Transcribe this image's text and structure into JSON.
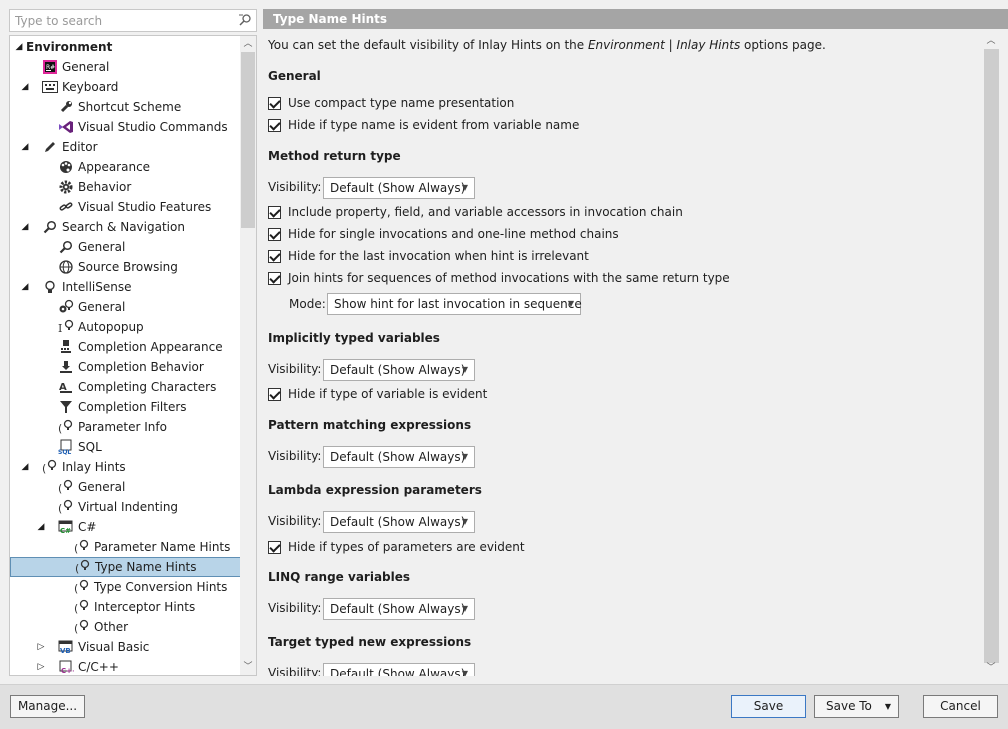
{
  "search": {
    "placeholder": "Type to search"
  },
  "tree": {
    "items": [
      {
        "label": "Environment",
        "bold": true,
        "expanded": true,
        "icon": "none"
      },
      {
        "label": "General",
        "icon": "resharper-icon"
      },
      {
        "label": "Keyboard",
        "expanded": true,
        "icon": "keyboard-icon"
      },
      {
        "label": "Shortcut Scheme",
        "icon": "wrench-icon"
      },
      {
        "label": "Visual Studio Commands",
        "icon": "visual-studio-icon"
      },
      {
        "label": "Editor",
        "expanded": true,
        "icon": "pencil-icon"
      },
      {
        "label": "Appearance",
        "icon": "palette-icon"
      },
      {
        "label": "Behavior",
        "icon": "gear-icon"
      },
      {
        "label": "Visual Studio Features",
        "icon": "link-icon"
      },
      {
        "label": "Search & Navigation",
        "expanded": true,
        "icon": "magnifier-icon"
      },
      {
        "label": "General",
        "icon": "magnifier-icon"
      },
      {
        "label": "Source Browsing",
        "icon": "globe-icon"
      },
      {
        "label": "IntelliSense",
        "expanded": true,
        "icon": "lightbulb-icon"
      },
      {
        "label": "General",
        "icon": "intellisense-gear-icon"
      },
      {
        "label": "Autopopup",
        "icon": "autopopup-icon"
      },
      {
        "label": "Completion Appearance",
        "icon": "completion-appearance-icon"
      },
      {
        "label": "Completion Behavior",
        "icon": "completion-behavior-icon"
      },
      {
        "label": "Completing Characters",
        "icon": "completing-characters-icon"
      },
      {
        "label": "Completion Filters",
        "icon": "filter-icon"
      },
      {
        "label": "Parameter Info",
        "icon": "parameter-info-icon"
      },
      {
        "label": "SQL",
        "icon": "sql-icon"
      },
      {
        "label": "Inlay Hints",
        "expanded": true,
        "icon": "inlay-hints-icon"
      },
      {
        "label": "General",
        "icon": "inlay-hints-icon"
      },
      {
        "label": "Virtual Indenting",
        "icon": "inlay-hints-icon"
      },
      {
        "label": "C#",
        "expanded": true,
        "icon": "csharp-icon"
      },
      {
        "label": "Parameter Name Hints",
        "icon": "inlay-hints-icon"
      },
      {
        "label": "Type Name Hints",
        "icon": "inlay-hints-icon",
        "selected": true
      },
      {
        "label": "Type Conversion Hints",
        "icon": "inlay-hints-icon"
      },
      {
        "label": "Interceptor Hints",
        "icon": "inlay-hints-icon"
      },
      {
        "label": "Other",
        "icon": "inlay-hints-icon"
      },
      {
        "label": "Visual Basic",
        "expanded": false,
        "icon": "vb-icon"
      },
      {
        "label": "C/C++",
        "expanded": false,
        "icon": "cpp-icon"
      }
    ]
  },
  "page": {
    "title": "Type Name Hints",
    "intro_prefix": "You can set the default visibility of Inlay Hints on the ",
    "intro_link": "Environment | Inlay Hints",
    "intro_suffix": " options page.",
    "visibility_label": "Visibility:",
    "default_visibility": "Default (Show Always)",
    "general": {
      "title": "General",
      "compact": "Use compact type name presentation",
      "evident_from_var": "Hide if type name is evident from variable name"
    },
    "method_return": {
      "title": "Method return type",
      "include_accessors": "Include property, field, and variable accessors in invocation chain",
      "single_invocations": "Hide for single invocations and one-line method chains",
      "last_invocation": "Hide for the last invocation when hint is irrelevant",
      "join_hints": "Join hints for sequences of method invocations with the same return type",
      "mode_label": "Mode:",
      "mode_value": "Show hint for last invocation in sequence"
    },
    "implicit": {
      "title": "Implicitly typed variables",
      "hide_evident": "Hide if type of variable is evident"
    },
    "pattern": {
      "title": "Pattern matching expressions"
    },
    "lambda": {
      "title": "Lambda expression parameters",
      "hide_evident": "Hide if types of parameters are evident"
    },
    "linq": {
      "title": "LINQ range variables"
    },
    "target_new": {
      "title": "Target typed new expressions"
    }
  },
  "footer": {
    "manage": "Manage...",
    "save": "Save",
    "save_to": "Save To",
    "cancel": "Cancel"
  },
  "colors": {
    "header_bg": "#a5a5a5",
    "selection_bg": "#b8d4e8",
    "primary_border": "#3b78c4"
  }
}
